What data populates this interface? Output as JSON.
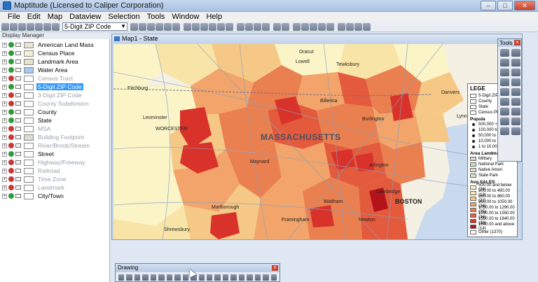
{
  "app": {
    "title": "Maptitude (Licensed to Caliper Corporation)",
    "window_buttons": [
      "–",
      "□",
      "✕"
    ]
  },
  "menu": [
    "File",
    "Edit",
    "Map",
    "Dataview",
    "Selection",
    "Tools",
    "Window",
    "Help"
  ],
  "toolbar": {
    "layer_select_value": "5-Digit ZIP Code"
  },
  "display_manager": {
    "title": "Display Manager",
    "layers": [
      {
        "name": "American Land Mass",
        "visible": true,
        "swatch": "#e8e4d4",
        "dim": false
      },
      {
        "name": "Census Place",
        "visible": true,
        "swatch": "#f5efd6",
        "dim": false
      },
      {
        "name": "Landmark Area",
        "visible": true,
        "swatch": "#e7e2cf",
        "dim": false
      },
      {
        "name": "Water Area",
        "visible": true,
        "swatch": "#a9c8ee",
        "dim": false
      },
      {
        "name": "Census Tract",
        "visible": false,
        "swatch": "#ffffff",
        "dim": true
      },
      {
        "name": "5-Digit ZIP Code",
        "visible": true,
        "swatch": "#ffffff",
        "dim": false,
        "selected": true
      },
      {
        "name": "3-Digit ZIP Code",
        "visible": false,
        "swatch": "#ffffff",
        "dim": true
      },
      {
        "name": "County Subdivision",
        "visible": false,
        "swatch": "#ffffff",
        "dim": true
      },
      {
        "name": "County",
        "visible": true,
        "swatch": "#ffffff",
        "dim": false
      },
      {
        "name": "State",
        "visible": true,
        "swatch": "#ffffff",
        "dim": false
      },
      {
        "name": "MSA",
        "visible": false,
        "swatch": "#ffffff",
        "dim": true
      },
      {
        "name": "Building Footprint",
        "visible": false,
        "swatch": "#e0ddd0",
        "dim": true
      },
      {
        "name": "River/Brook/Stream",
        "visible": false,
        "swatch": "#ffffff",
        "dim": true
      },
      {
        "name": "Street",
        "visible": true,
        "swatch": "#ffffff",
        "dim": false
      },
      {
        "name": "Highway/Freeway",
        "visible": false,
        "swatch": "#ffffff",
        "dim": true
      },
      {
        "name": "Railroad",
        "visible": false,
        "swatch": "#ffffff",
        "dim": true
      },
      {
        "name": "Time Zone",
        "visible": false,
        "swatch": "#ffffff",
        "dim": true
      },
      {
        "name": "Landmark",
        "visible": false,
        "swatch": "#ffffff",
        "dim": true
      },
      {
        "name": "City/Town",
        "visible": true,
        "swatch": "#ffffff",
        "dim": false
      }
    ]
  },
  "map": {
    "window_title": "Map1 - State",
    "state_label": "MASSACHUSETTS",
    "place_labels": [
      "Dracut",
      "Lowell",
      "Tewksbury",
      "Fitchburg",
      "Billerica",
      "Danvers",
      "Leominster",
      "Lynn",
      "Burlington",
      "WORCESTER",
      "Maynard",
      "Arlington",
      "Waltham",
      "Cambridge",
      "BOSTON",
      "Marlborough",
      "Shrewsbury",
      "Newton",
      "Framingham"
    ]
  },
  "legend": {
    "title": "LEGE",
    "boundary_items": [
      "5-Digit ZIP Code",
      "County",
      "State",
      "Census Place"
    ],
    "population_title": "Popula",
    "population_items": [
      "500,000 +",
      "100,000 to 4",
      "50,000 to 99",
      "10,000 to 49",
      "1 to 10,000"
    ],
    "landmark_title": "Area Landma",
    "landmark_items": [
      "Military",
      "National Park",
      "Native Ameri",
      "State Park"
    ],
    "sales_title": "Avg SALES",
    "sales_items": [
      {
        "label": "500.00 and below (24)",
        "color": "#fbf4c7"
      },
      {
        "label": "500.00 to 490.00 (13)",
        "color": "#f9e4a7"
      },
      {
        "label": "680.00 to 860.00 (21)",
        "color": "#f6c886"
      },
      {
        "label": "860.00 to 1050.00 (26)",
        "color": "#f2a46a"
      },
      {
        "label": "1050.00 to 1290.00 (35)",
        "color": "#ea7f4f"
      },
      {
        "label": "1290.00 to 1550.00 (36)",
        "color": "#e35a3c"
      },
      {
        "label": "1550.00 to 1840.00 (38)",
        "color": "#d8322a"
      },
      {
        "label": "1840.00 and above (14)",
        "color": "#b5131b"
      },
      {
        "label": "Other (1370)",
        "color": "#ffffff"
      }
    ]
  },
  "tools": {
    "title": "Tools",
    "close": "x"
  },
  "drawing": {
    "title": "Drawing",
    "close": "x"
  }
}
